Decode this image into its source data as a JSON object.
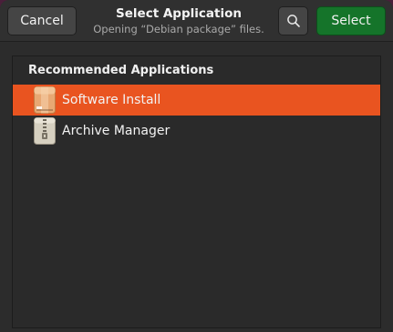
{
  "dialog": {
    "title": "Select Application",
    "subtitle": "Opening “Debian package” files."
  },
  "header": {
    "cancel_label": "Cancel",
    "search_icon": "search-icon",
    "select_label": "Select"
  },
  "list": {
    "section_title": "Recommended Applications",
    "items": [
      {
        "label": "Software Install",
        "icon": "package-icon",
        "selected": true
      },
      {
        "label": "Archive Manager",
        "icon": "archive-zipper-icon",
        "selected": false
      }
    ]
  },
  "colors": {
    "accent": "#e95420",
    "select_button": "#15742a",
    "background": "#2c2c2c"
  }
}
